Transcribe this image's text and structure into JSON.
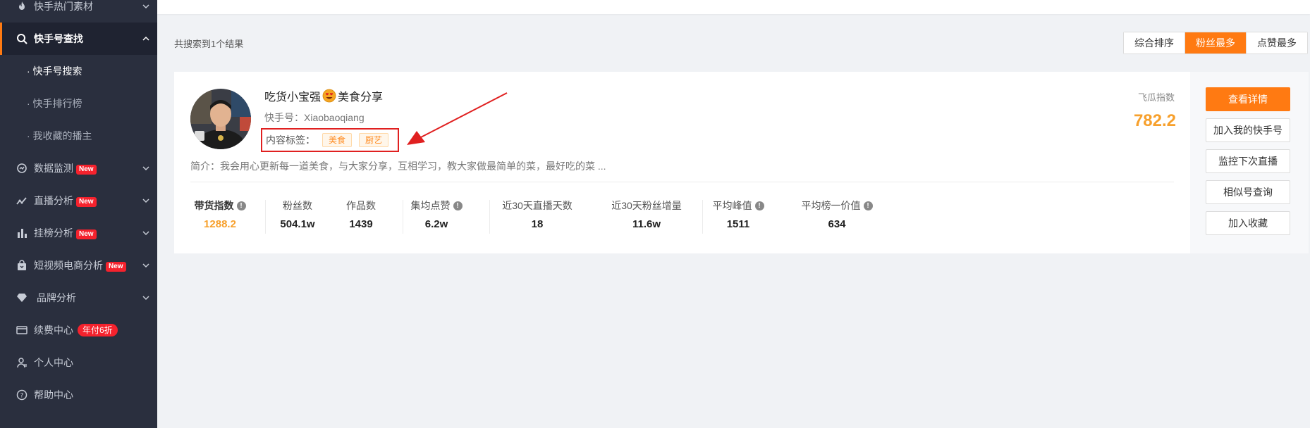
{
  "sidebar": {
    "items": [
      {
        "label": "快手热门素材",
        "icon": "fire-icon"
      },
      {
        "label": "快手号查找",
        "icon": "search-icon"
      },
      {
        "label": "数据监测",
        "icon": "monitor-icon",
        "badge": "New"
      },
      {
        "label": "直播分析",
        "icon": "trend-icon",
        "badge": "New"
      },
      {
        "label": "挂榜分析",
        "icon": "bar-chart-icon",
        "badge": "New"
      },
      {
        "label": "短视频电商分析",
        "icon": "shopping-bag-icon",
        "badge": "New"
      },
      {
        "label": "品牌分析",
        "icon": "diamond-icon"
      },
      {
        "label": "续费中心",
        "icon": "card-icon",
        "badge": "年付6折"
      },
      {
        "label": "个人中心",
        "icon": "user-icon"
      },
      {
        "label": "帮助中心",
        "icon": "help-icon"
      }
    ],
    "sub_items": [
      "· 快手号搜索",
      "· 快手排行榜",
      "· 我收藏的播主"
    ]
  },
  "results": {
    "count_text": "共搜索到1个结果",
    "sort_options": [
      "综合排序",
      "粉丝最多",
      "点赞最多"
    ],
    "active_sort": "粉丝最多"
  },
  "card": {
    "name_prefix": "吃货小宝强",
    "name_suffix": "美食分享",
    "account": "快手号：Xiaobaoqiang",
    "tags_label": "内容标签：",
    "tags": [
      "美食",
      "厨艺"
    ],
    "intro": "简介：我会用心更新每一道美食，与大家分享，互相学习，教大家做最简单的菜，最好吃的菜 ...",
    "feigua_label": "飞瓜指数",
    "feigua_value": "782.2",
    "stats": [
      {
        "label": "带货指数",
        "value": "1288.2",
        "help": true
      },
      {
        "label": "粉丝数",
        "value": "504.1w"
      },
      {
        "label": "作品数",
        "value": "1439"
      },
      {
        "label": "集均点赞",
        "value": "6.2w",
        "help": true
      },
      {
        "label": "近30天直播天数",
        "value": "18"
      },
      {
        "label": "近30天粉丝增量",
        "value": "11.6w"
      },
      {
        "label": "平均峰值",
        "value": "1511",
        "help": true
      },
      {
        "label": "平均榜一价值",
        "value": "634",
        "help": true
      }
    ]
  },
  "actions": [
    "查看详情",
    "加入我的快手号",
    "监控下次直播",
    "相似号查询",
    "加入收藏"
  ],
  "colors": {
    "accent": "#ff7a12",
    "sidebar_bg": "#2a2f3e",
    "highlight": "#e02020",
    "metric": "#f7a02c"
  }
}
